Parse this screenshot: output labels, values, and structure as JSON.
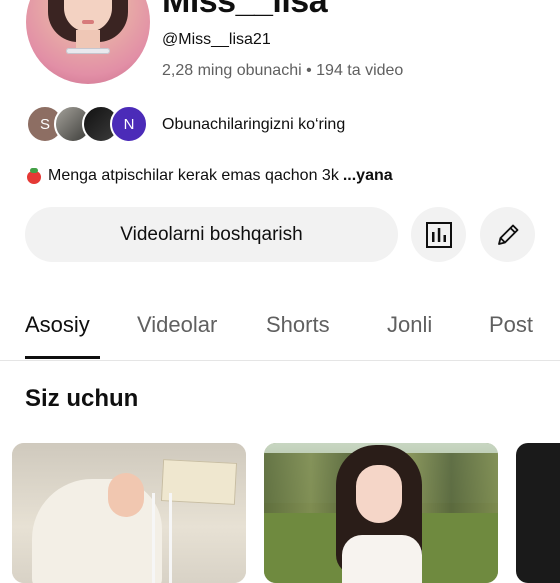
{
  "channel": {
    "name": "Miss__lisa",
    "handle": "@Miss__lisa21",
    "stats": "2,28 ming obunachi • 194 ta video"
  },
  "subscribers": {
    "avatars": [
      "S",
      "",
      "",
      "N"
    ],
    "label": "Obunachilaringizni ko‘ring"
  },
  "description": {
    "text": "Menga atpischilar kerak emas qachon 3k",
    "more": "...yana"
  },
  "actions": {
    "manage_label": "Videolarni boshqarish",
    "analytics_icon": "analytics-icon",
    "edit_icon": "pencil-icon"
  },
  "tabs": [
    "Asosiy",
    "Videolar",
    "Shorts",
    "Jonli",
    "Post"
  ],
  "active_tab": "Asosiy",
  "section": {
    "title": "Siz uchun"
  },
  "colors": {
    "text": "#0f0f0f",
    "secondary": "#606060",
    "button_bg": "#f2f2f2",
    "avatar_n": "#4b2bb8",
    "avatar_s": "#8d6e63"
  }
}
